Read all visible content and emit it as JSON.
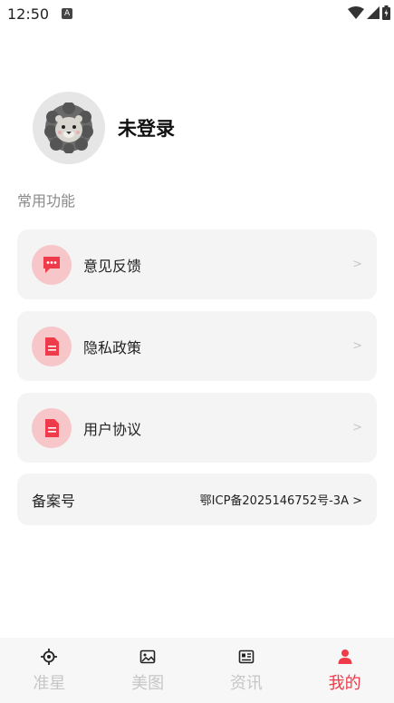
{
  "status_bar": {
    "time": "12:50",
    "notification_badge": "A"
  },
  "profile": {
    "name": "未登录"
  },
  "section": {
    "title": "常用功能"
  },
  "menu": [
    {
      "label": "意见反馈",
      "icon": "chat-bubble-icon",
      "chevron": ">"
    },
    {
      "label": "隐私政策",
      "icon": "document-icon",
      "chevron": ">"
    },
    {
      "label": "用户协议",
      "icon": "document-icon",
      "chevron": ">"
    }
  ],
  "icp": {
    "label": "备案号",
    "value": "鄂ICP备2025146752号-3A >"
  },
  "bottom_nav": [
    {
      "label": "准星",
      "icon": "crosshair-icon",
      "active": false
    },
    {
      "label": "美图",
      "icon": "image-icon",
      "active": false
    },
    {
      "label": "资讯",
      "icon": "news-icon",
      "active": false
    },
    {
      "label": "我的",
      "icon": "person-icon",
      "active": true
    }
  ],
  "colors": {
    "accent": "#ef3a4a",
    "icon_bg": "#f7c6c9",
    "card_bg": "#f4f4f4"
  }
}
